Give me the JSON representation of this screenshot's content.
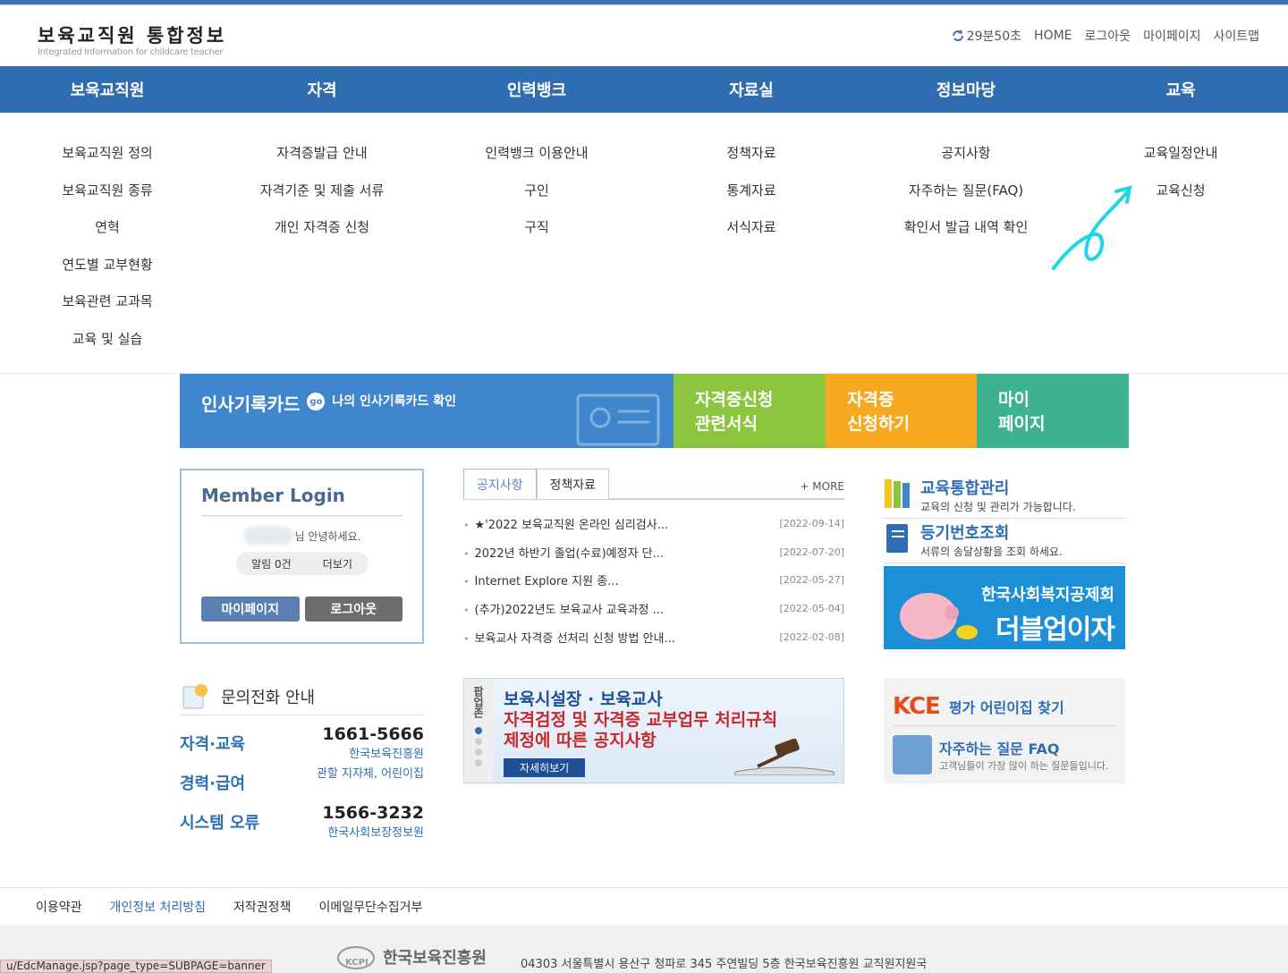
{
  "header": {
    "logo_title": "보육교직원 통합정보",
    "logo_sub": "Integrated Information for childcare teacher",
    "timer": "29분50초",
    "util": [
      "HOME",
      "로그아웃",
      "마이페이지",
      "사이트맵"
    ]
  },
  "gnb": [
    "보육교직원",
    "자격",
    "인력뱅크",
    "자료실",
    "정보마당",
    "교육"
  ],
  "submenu": [
    [
      "보육교직원 정의",
      "보육교직원 종류",
      "연혁",
      "연도별 교부현황",
      "보육관련 교과목",
      "교육 및 실습"
    ],
    [
      "자격증발급 안내",
      "자격기준 및 제출 서류",
      "개인 자격증 신청"
    ],
    [
      "인력뱅크 이용안내",
      "구인",
      "구직"
    ],
    [
      "정책자료",
      "통계자료",
      "서식자료"
    ],
    [
      "공지사항",
      "자주하는 질문(FAQ)",
      "확인서 발급 내역 확인"
    ],
    [
      "교육일정안내",
      "교육신청"
    ]
  ],
  "banners": {
    "card_title": "인사기록카드",
    "card_go": "go",
    "card_desc": "나의 인사기록카드 확인",
    "b2": [
      "자격증신청",
      "관련서식"
    ],
    "b3": [
      "자격증",
      "신청하기"
    ],
    "b4": [
      "마이",
      "페이지"
    ]
  },
  "login": {
    "title": "Member Login",
    "greeting": "님 안녕하세요.",
    "alarm": "알림 0건",
    "more": "더보기",
    "mypage": "마이페이지",
    "logout": "로그아웃"
  },
  "board": {
    "tabs": [
      "공지사항",
      "정책자료"
    ],
    "more": "+ MORE",
    "items": [
      {
        "title": "★'2022 보육교직원 온라인 심리검사...",
        "date": "[2022-09-14]"
      },
      {
        "title": "2022년 하반기 졸업(수료)예정자 단...",
        "date": "[2022-07-20]"
      },
      {
        "title": "Internet Explore 지원 종...",
        "date": "[2022-05-27]"
      },
      {
        "title": "(추가)2022년도 보육교사 교육과정 ...",
        "date": "[2022-05-04]"
      },
      {
        "title": "보육교사 자격증 선처리 신청 방법 안내...",
        "date": "[2022-02-08]"
      }
    ]
  },
  "right": {
    "edu_title": "교육통합관리",
    "edu_desc": "교육의 신청 및 관리가 가능합니다.",
    "reg_title": "등기번호조회",
    "reg_desc": "서류의 송달상황을 조회 하세요.",
    "piggy_1": "한국사회복지공제회",
    "piggy_2": "더블업이자"
  },
  "contact": {
    "title": "문의전화 안내",
    "rows": [
      {
        "label": "자격·교육",
        "num": "1661-5666",
        "org": "한국보육진흥원"
      },
      {
        "label": "경력·급여",
        "num": "",
        "org": "관할 지자체, 어린이집"
      },
      {
        "label": "시스템 오류",
        "num": "1566-3232",
        "org": "한국사회보장정보원"
      }
    ]
  },
  "popup": {
    "vlabel": "팝업존",
    "line1": "보육시설장 · 보육교사",
    "line2": "자격검정 및 자격증 교부업무 처리규칙",
    "line3": "제정에 따른 공지사항",
    "btn": "자세히보기"
  },
  "kce": {
    "logo": "KCE",
    "title": "평가 어린이집 찾기",
    "faq_title": "자주하는 질문 FAQ",
    "faq_desc": "고객님들이 가장 많이 하는 질문들입니다."
  },
  "footer": {
    "links": [
      "이용약관",
      "개인정보 처리방침",
      "저작권정책",
      "이메일무단수집거부"
    ],
    "org": "한국보육진흥원",
    "org_mark": "KCPI",
    "address": "04303 서울특별시 용산구 청파로 345 주연빌딩 5층 한국보육진흥원 교직원지원국"
  },
  "status_url": "u/EdcManage.jsp?page_type=SUBPAGE=banner"
}
